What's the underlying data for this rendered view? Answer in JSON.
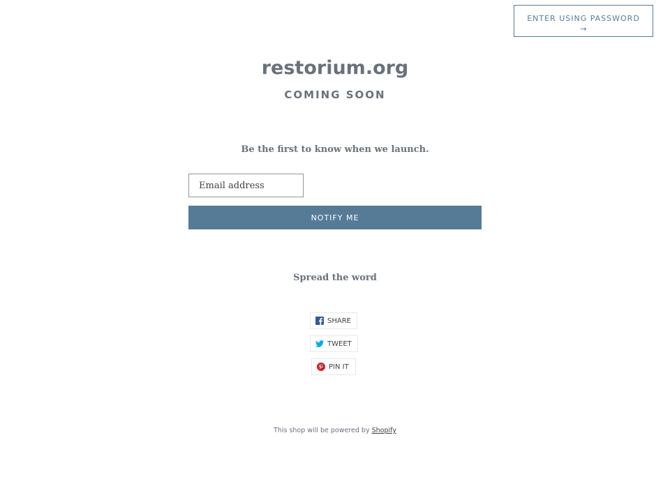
{
  "header": {
    "password_button_label": "ENTER USING PASSWORD",
    "password_button_arrow": "→"
  },
  "hero": {
    "shop_name": "restorium.org",
    "subtitle": "COMING SOON"
  },
  "signup": {
    "tagline": "Be the first to know when we launch.",
    "email_placeholder": "Email address",
    "email_value": "",
    "notify_button_label": "NOTIFY ME"
  },
  "share": {
    "heading": "Spread the word",
    "buttons": [
      {
        "label": "SHARE",
        "icon": "facebook-icon",
        "color": "#3b5998"
      },
      {
        "label": "TWEET",
        "icon": "twitter-icon",
        "color": "#00aced"
      },
      {
        "label": "PIN IT",
        "icon": "pinterest-icon",
        "color": "#cb2027"
      }
    ]
  },
  "footer": {
    "text": "This shop will be powered by",
    "link_label": "Shopify"
  },
  "colors": {
    "accent": "#557b97",
    "text": "#69727b",
    "dark_text": "#3d4246"
  }
}
